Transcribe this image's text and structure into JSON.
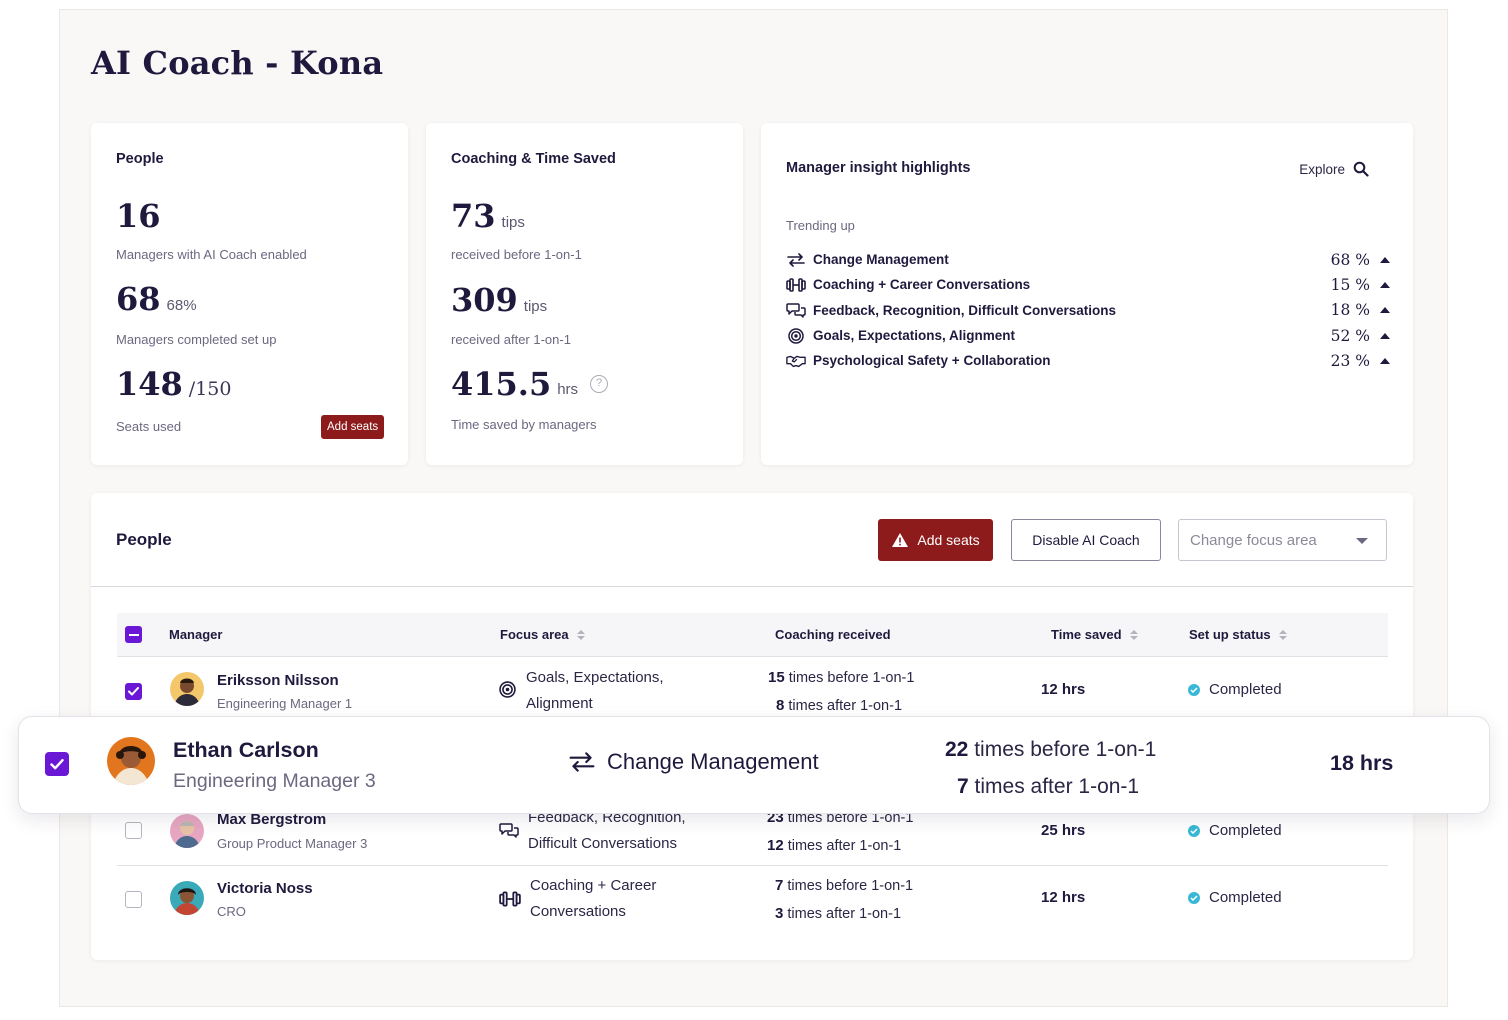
{
  "page": {
    "title": "AI Coach - Kona"
  },
  "people_card": {
    "title": "People",
    "managers_enabled": {
      "value": "16",
      "label": "Managers with AI Coach enabled"
    },
    "managers_setup": {
      "value": "68",
      "pct": "68%",
      "label": "Managers completed set up"
    },
    "seats": {
      "value": "148",
      "total": "/150",
      "label": "Seats used",
      "button": "Add seats"
    }
  },
  "coaching_card": {
    "title": "Coaching & Time Saved",
    "before": {
      "value": "73",
      "unit": "tips",
      "label": "received before 1-on-1"
    },
    "after": {
      "value": "309",
      "unit": "tips",
      "label": "received after 1-on-1"
    },
    "time": {
      "value": "415.5",
      "unit": "hrs",
      "help": "?",
      "label": "Time saved by managers"
    }
  },
  "insights_card": {
    "title": "Manager insight highlights",
    "explore": "Explore",
    "trend_label": "Trending up",
    "items": [
      {
        "icon": "swap-arrows-icon",
        "name": "Change Management",
        "pct": "68 %"
      },
      {
        "icon": "dumbbell-icon",
        "name": "Coaching + Career Conversations",
        "pct": "15 %"
      },
      {
        "icon": "chat-bubbles-icon",
        "name": "Feedback, Recognition, Difficult Conversations",
        "pct": "18 %"
      },
      {
        "icon": "target-icon",
        "name": "Goals, Expectations, Alignment",
        "pct": "52 %"
      },
      {
        "icon": "handshake-icon",
        "name": "Psychological Safety + Collaboration",
        "pct": "23 %"
      }
    ]
  },
  "people_table": {
    "title": "People",
    "add_seats": "Add seats",
    "disable": "Disable AI Coach",
    "focus_select": {
      "placeholder": "Change focus area"
    },
    "columns": {
      "manager": "Manager",
      "focus": "Focus area",
      "coaching": "Coaching received",
      "time": "Time saved",
      "status": "Set up status"
    },
    "rows": [
      {
        "checked": true,
        "name": "Eriksson Nilsson",
        "role": "Engineering Manager 1",
        "focus_icon": "target-icon",
        "focus_line1": "Goals, Expectations,",
        "focus_line2": "Alignment",
        "before_n": "15",
        "before_text": "times before 1-on-1",
        "after_n": "8",
        "after_text": "times after 1-on-1",
        "time": "12 hrs",
        "status": "Completed"
      },
      {
        "checked": false,
        "name": "Max Bergstrom",
        "role": "Group Product Manager 3",
        "focus_icon": "chat-bubbles-icon",
        "focus_line1": "Feedback, Recognition,",
        "focus_line2": "Difficult Conversations",
        "before_n": "23",
        "before_text": "times before 1-on-1",
        "after_n": "12",
        "after_text": "times after 1-on-1",
        "time": "25 hrs",
        "status": "Completed"
      },
      {
        "checked": false,
        "name": "Victoria Noss",
        "role": "CRO",
        "focus_icon": "dumbbell-icon",
        "focus_line1": "Coaching + Career",
        "focus_line2": "Conversations",
        "before_n": "7",
        "before_text": "times before 1-on-1",
        "after_n": "3",
        "after_text": "times after 1-on-1",
        "time": "12 hrs",
        "status": "Completed"
      }
    ]
  },
  "highlight_row": {
    "checked": true,
    "name": "Ethan Carlson",
    "role": "Engineering Manager 3",
    "focus_icon": "swap-arrows-icon",
    "focus": "Change Management",
    "before_n": "22",
    "before_text": "times before 1-on-1",
    "after_n": "7",
    "after_text": "times after 1-on-1",
    "time": "18 hrs"
  },
  "colors": {
    "brand_red": "#8e1b1b",
    "checkbox_purple": "#6a18d6",
    "status_teal": "#38b8d6",
    "ink": "#1f1a3d"
  }
}
